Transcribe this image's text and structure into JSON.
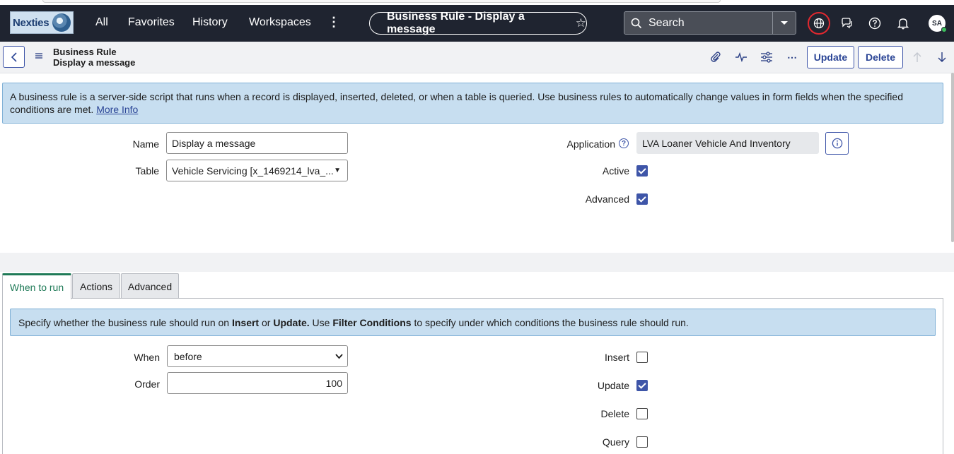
{
  "nav": {
    "logo_text": "Nexties",
    "items": [
      "All",
      "Favorites",
      "History",
      "Workspaces"
    ],
    "pill_title": "Business Rule - Display a message",
    "search_label": "Search",
    "avatar_initials": "SA"
  },
  "header": {
    "record_type": "Business Rule",
    "record_name": "Display a message",
    "update_label": "Update",
    "delete_label": "Delete"
  },
  "banner": {
    "text": "A business rule is a server-side script that runs when a record is displayed, inserted, deleted, or when a table is queried. Use business rules to automatically change values in form fields when the specified conditions are met.",
    "link": "More Info"
  },
  "form": {
    "name_label": "Name",
    "name_value": "Display a message",
    "table_label": "Table",
    "table_value": "Vehicle Servicing [x_1469214_lva_...",
    "application_label": "Application",
    "application_value": "LVA Loaner Vehicle And Inventory",
    "active_label": "Active",
    "active_checked": true,
    "advanced_label": "Advanced",
    "advanced_checked": true
  },
  "tabs": {
    "when_to_run": "When to run",
    "actions": "Actions",
    "advanced": "Advanced"
  },
  "when_panel": {
    "banner_parts": {
      "p1": "Specify whether the business rule should run on ",
      "insert": "Insert",
      "p2": " or ",
      "update": "Update.",
      "p3": " Use ",
      "filter": "Filter Conditions",
      "p4": " to specify under which conditions the business rule should run."
    },
    "when_label": "When",
    "when_value": "before",
    "order_label": "Order",
    "order_value": "100",
    "insert_label": "Insert",
    "insert_checked": false,
    "update_label": "Update",
    "update_checked": true,
    "delete_label": "Delete",
    "delete_checked": false,
    "query_label": "Query",
    "query_checked": false
  },
  "colors": {
    "nav_bg": "#1f2430",
    "accent": "#3e55a8",
    "tab_active": "#1f7a57",
    "banner_bg": "#c7def0",
    "globe_ring": "#e0282f"
  }
}
